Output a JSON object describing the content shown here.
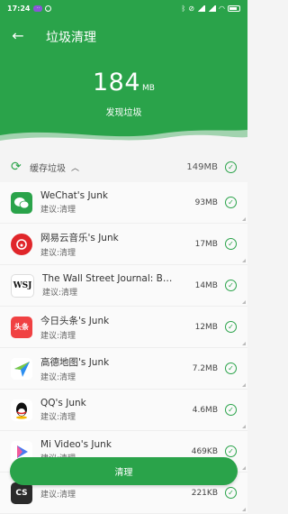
{
  "status_bar": {
    "time": "17:24"
  },
  "header": {
    "title": "垃圾清理",
    "junk_size": "184",
    "junk_unit": "MB",
    "found_label": "发现垃圾",
    "background_color": "#2aa34a"
  },
  "cache_section": {
    "label": "缓存垃圾",
    "size": "149MB"
  },
  "items": [
    {
      "name": "WeChat's Junk",
      "suggest": "建议:清理",
      "size": "93MB",
      "icon": "wechat-icon",
      "icon_color": "#2aa34a",
      "icon_text": ""
    },
    {
      "name": "网易云音乐's Junk",
      "suggest": "建议:清理",
      "size": "17MB",
      "icon": "netease-music-icon",
      "icon_color": "#e0262a",
      "icon_text": ""
    },
    {
      "name": "The Wall Street Journal: Busin…",
      "suggest": "建议:清理",
      "size": "14MB",
      "icon": "wsj-icon",
      "icon_color": "#ffffff",
      "icon_text": "WSJ"
    },
    {
      "name": "今日头条's Junk",
      "suggest": "建议:清理",
      "size": "12MB",
      "icon": "toutiao-icon",
      "icon_color": "#f04142",
      "icon_text": "头条"
    },
    {
      "name": "高德地图's Junk",
      "suggest": "建议:清理",
      "size": "7.2MB",
      "icon": "amap-icon",
      "icon_color": "#ffffff",
      "icon_text": ""
    },
    {
      "name": "QQ's Junk",
      "suggest": "建议:清理",
      "size": "4.6MB",
      "icon": "qq-icon",
      "icon_color": "#ffffff",
      "icon_text": ""
    },
    {
      "name": "Mi Video's Junk",
      "suggest": "建议:清理",
      "size": "469KB",
      "icon": "mi-video-icon",
      "icon_color": "#ffffff",
      "icon_text": ""
    },
    {
      "name": "",
      "suggest": "建议:清理",
      "size": "221KB",
      "icon": "app-icon",
      "icon_color": "#2b2b2b",
      "icon_text": "CS"
    }
  ],
  "clean_button": {
    "label": "清理"
  },
  "accent_color": "#2aa34a"
}
